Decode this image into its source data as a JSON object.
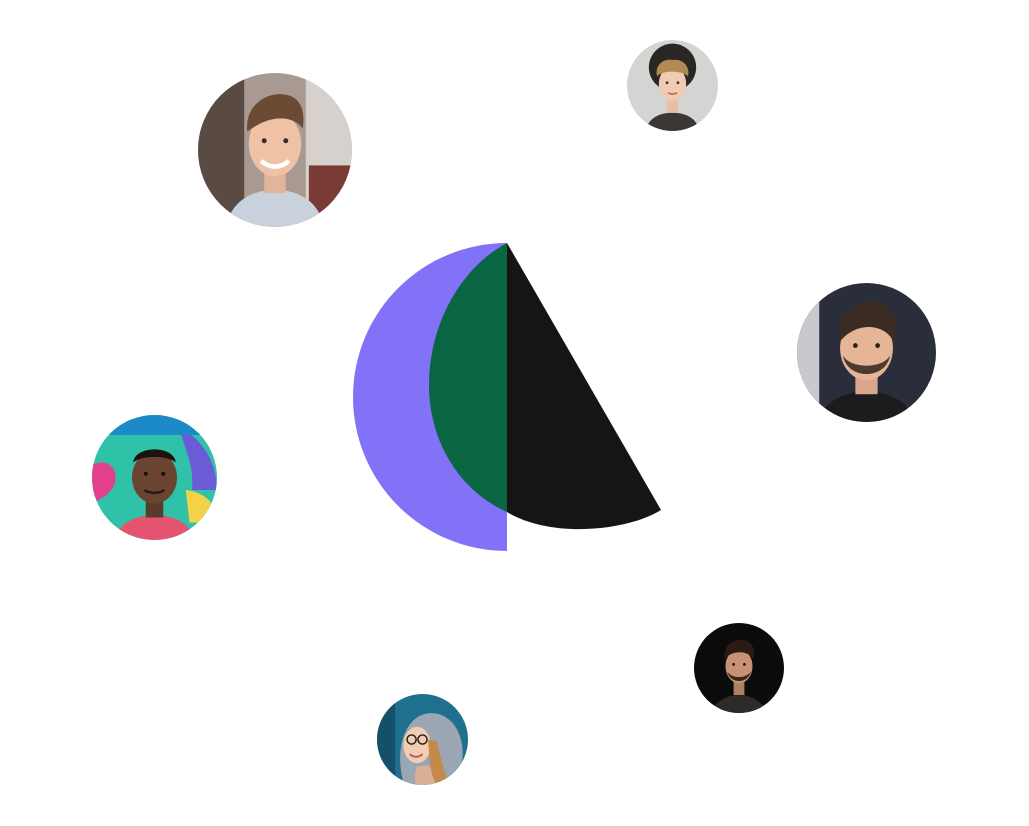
{
  "brand": {
    "colors": {
      "purple": "#8172f8",
      "green": "#0a6543",
      "black": "#161414",
      "background": "#ffffff"
    },
    "logo_icon": "abstract-moon-sail-logo-icon"
  },
  "avatars": [
    {
      "id": "avatar-smiling-man-brown-hair",
      "icon": "portrait-photo"
    },
    {
      "id": "avatar-curly-hair-young-man",
      "icon": "portrait-photo"
    },
    {
      "id": "avatar-bearded-man-dark-hair",
      "icon": "portrait-photo"
    },
    {
      "id": "avatar-man-graffiti-background",
      "icon": "portrait-photo"
    },
    {
      "id": "avatar-man-dark-background",
      "icon": "portrait-photo"
    },
    {
      "id": "avatar-woman-hood-glasses",
      "icon": "portrait-photo"
    }
  ]
}
